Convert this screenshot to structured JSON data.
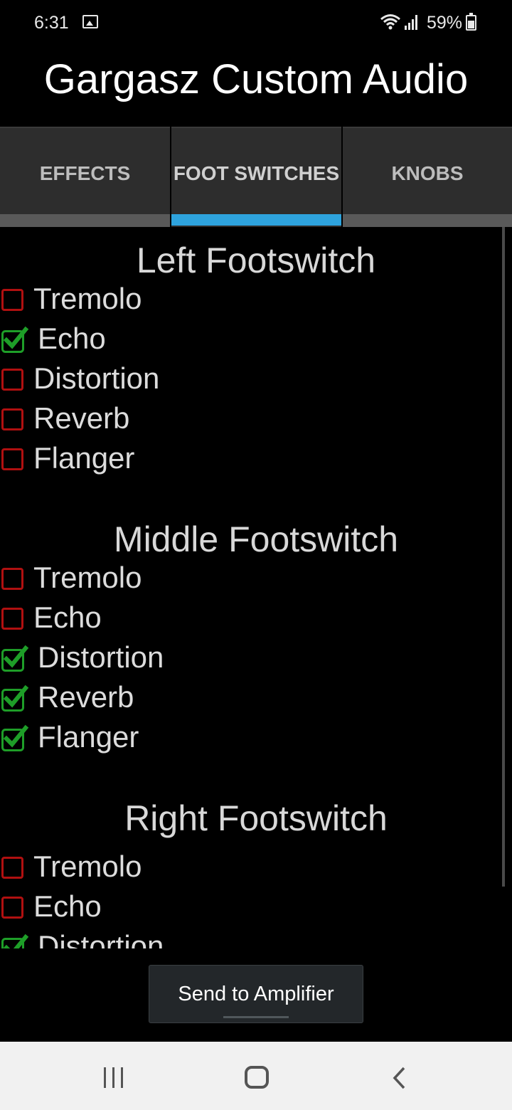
{
  "status_bar": {
    "time": "6:31",
    "battery": "59%",
    "icons": [
      "image-notification-icon",
      "wifi-icon",
      "signal-icon",
      "battery-charging-icon"
    ]
  },
  "app_title": "Gargasz Custom Audio",
  "tabs": [
    {
      "label": "EFFECTS",
      "active": false
    },
    {
      "label": "FOOT SWITCHES",
      "active": true
    },
    {
      "label": "KNOBS",
      "active": false
    }
  ],
  "accent_color": "#2ea3dd",
  "checkbox_colors": {
    "unchecked": "#b01010",
    "checked": "#1e9e28"
  },
  "footswitches": [
    {
      "title": "Left Footswitch",
      "options": [
        {
          "label": "Tremolo",
          "checked": false
        },
        {
          "label": "Echo",
          "checked": true
        },
        {
          "label": "Distortion",
          "checked": false
        },
        {
          "label": "Reverb",
          "checked": false
        },
        {
          "label": "Flanger",
          "checked": false
        }
      ]
    },
    {
      "title": "Middle Footswitch",
      "options": [
        {
          "label": "Tremolo",
          "checked": false
        },
        {
          "label": "Echo",
          "checked": false
        },
        {
          "label": "Distortion",
          "checked": true
        },
        {
          "label": "Reverb",
          "checked": true
        },
        {
          "label": "Flanger",
          "checked": true
        }
      ]
    },
    {
      "title": "Right Footswitch",
      "options": [
        {
          "label": "Tremolo",
          "checked": false
        },
        {
          "label": "Echo",
          "checked": false
        },
        {
          "label": "Distortion",
          "checked": true
        }
      ]
    }
  ],
  "send_button_label": "Send to Amplifier",
  "nav_bar": {
    "icons": [
      "recents-icon",
      "home-icon",
      "back-icon"
    ]
  }
}
